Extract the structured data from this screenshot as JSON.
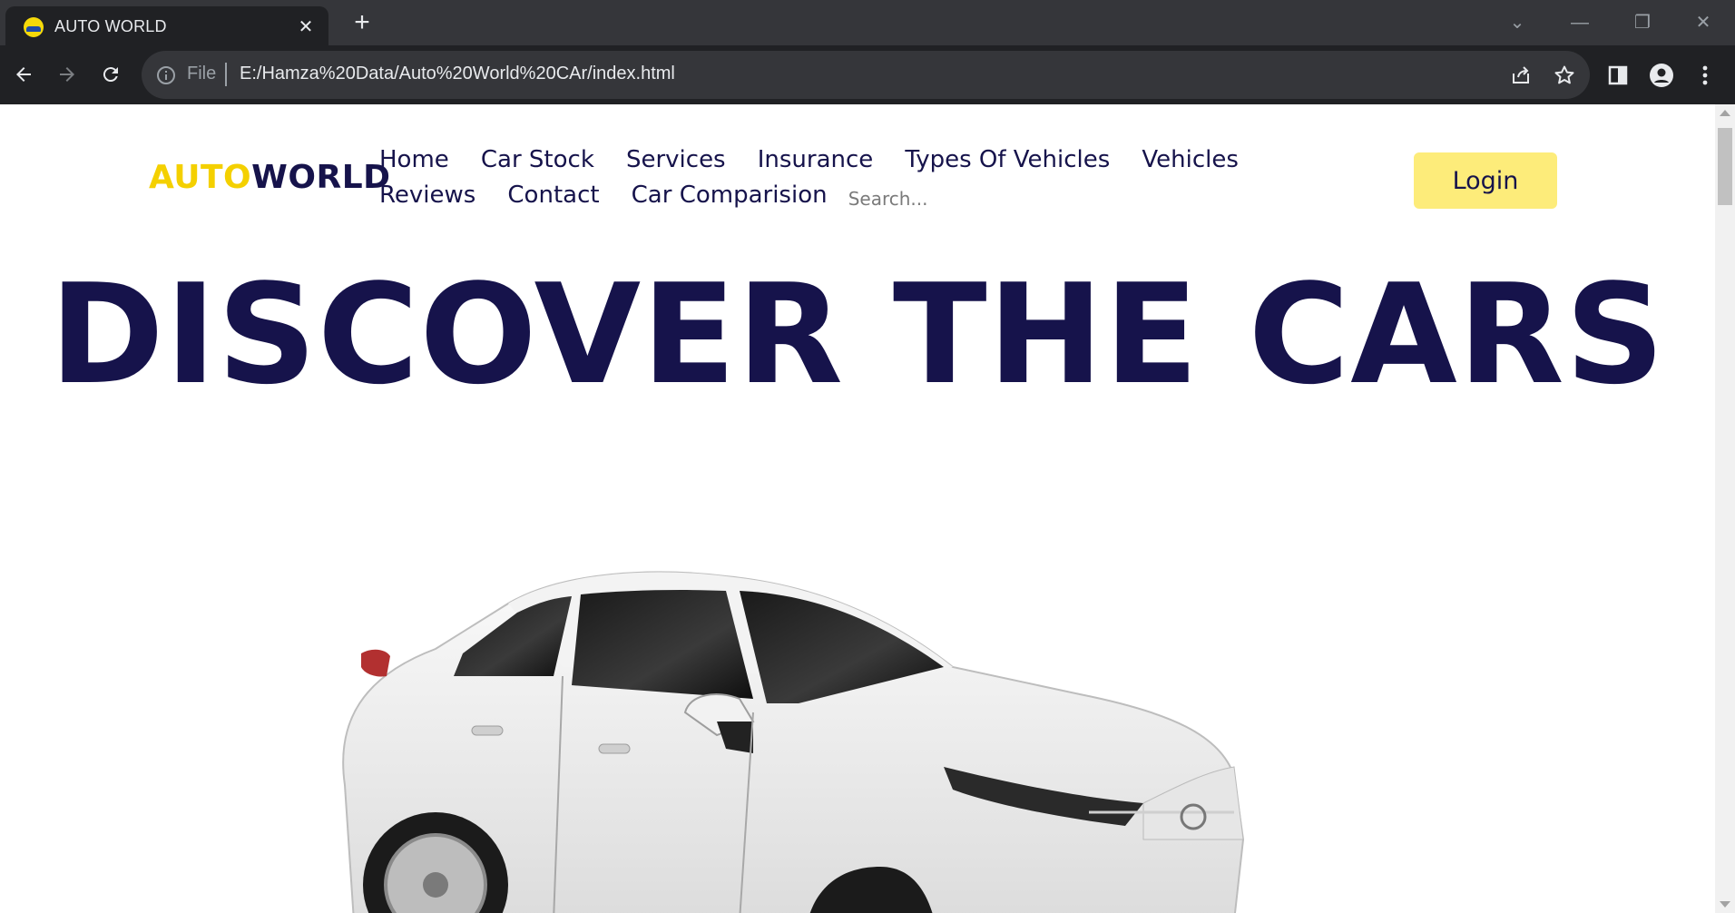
{
  "browser": {
    "tab_title": "AUTO WORLD",
    "tab_close": "✕",
    "new_tab": "+",
    "url_scheme": "File",
    "url": "E:/Hamza%20Data/Auto%20World%20CAr/index.html",
    "window_controls": {
      "dropdown": "⌄",
      "minimize": "—",
      "restore": "❐",
      "close": "✕"
    }
  },
  "site": {
    "logo_part1": "AUTO",
    "logo_part2": "WORLD",
    "nav": {
      "home": "Home",
      "car_stock": "Car Stock",
      "services": "Services",
      "insurance": "Insurance",
      "types_of_vehicles": "Types Of Vehicles",
      "vehicles": "Vehicles",
      "reviews": "Reviews",
      "contact": "Contact",
      "car_comparision": "Car Comparision"
    },
    "search_placeholder": "Search...",
    "login_label": "Login",
    "hero_title": "DISCOVER THE CARS"
  },
  "colors": {
    "brand_yellow": "#f4d000",
    "brand_navy": "#16134b",
    "login_bg": "#fdec7a"
  }
}
